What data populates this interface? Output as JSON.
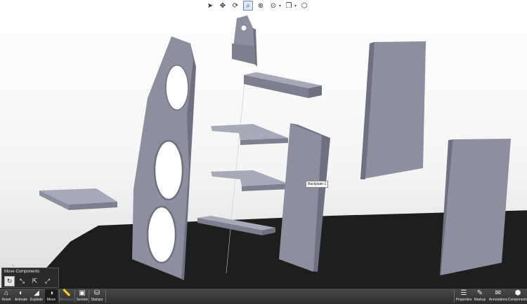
{
  "view_toolbar": {
    "tools": [
      {
        "name": "select-tool",
        "glyph": "➤"
      },
      {
        "name": "pan-tool",
        "glyph": "✥"
      },
      {
        "name": "rotate-tool",
        "glyph": "⟳"
      },
      {
        "name": "zoom-area-tool",
        "glyph": "⌕"
      },
      {
        "name": "zoom-in-tool",
        "glyph": "⊕"
      },
      {
        "name": "zoom-fit-tool",
        "glyph": "⊙"
      },
      {
        "name": "view-orientation-tool",
        "glyph": "❐"
      },
      {
        "name": "display-style-tool",
        "glyph": "⬡"
      }
    ],
    "dropdown_glyph": "▾"
  },
  "tooltip": {
    "text": "Backplate-1"
  },
  "move_panel": {
    "title": "Move Components",
    "options": [
      {
        "name": "free-drag-option",
        "glyph": "↻"
      },
      {
        "name": "triad-move-option",
        "glyph": "⤡"
      },
      {
        "name": "xyz-move-option",
        "glyph": "⇱"
      },
      {
        "name": "rotate-option",
        "glyph": "⤢"
      }
    ]
  },
  "bottom_toolbar": {
    "left": [
      {
        "name": "reset",
        "label": "Reset",
        "glyph": "⌂"
      },
      {
        "name": "animate",
        "label": "Animate",
        "glyph": "◐"
      },
      {
        "name": "explode",
        "label": "Explode",
        "glyph": "◢"
      },
      {
        "name": "move",
        "label": "Move",
        "glyph": "◑"
      },
      {
        "name": "measure",
        "label": "Measure",
        "glyph": "📏"
      },
      {
        "name": "section",
        "label": "Section",
        "glyph": "▣"
      },
      {
        "name": "stamps",
        "label": "Stamps",
        "glyph": "⛁"
      }
    ],
    "right": [
      {
        "name": "properties",
        "label": "Properties",
        "glyph": "☰"
      },
      {
        "name": "markup",
        "label": "Markup",
        "glyph": "✎"
      },
      {
        "name": "annotations",
        "label": "Annotations",
        "glyph": "✉"
      },
      {
        "name": "components",
        "label": "Components",
        "glyph": "⬢"
      }
    ]
  },
  "colors": {
    "part_face": "#8d8f9e",
    "part_top": "#a7a9b7",
    "part_edge": "#6f7180",
    "shadow": "#1c1c1c",
    "toolbar_bg": "#3a3a3a"
  }
}
